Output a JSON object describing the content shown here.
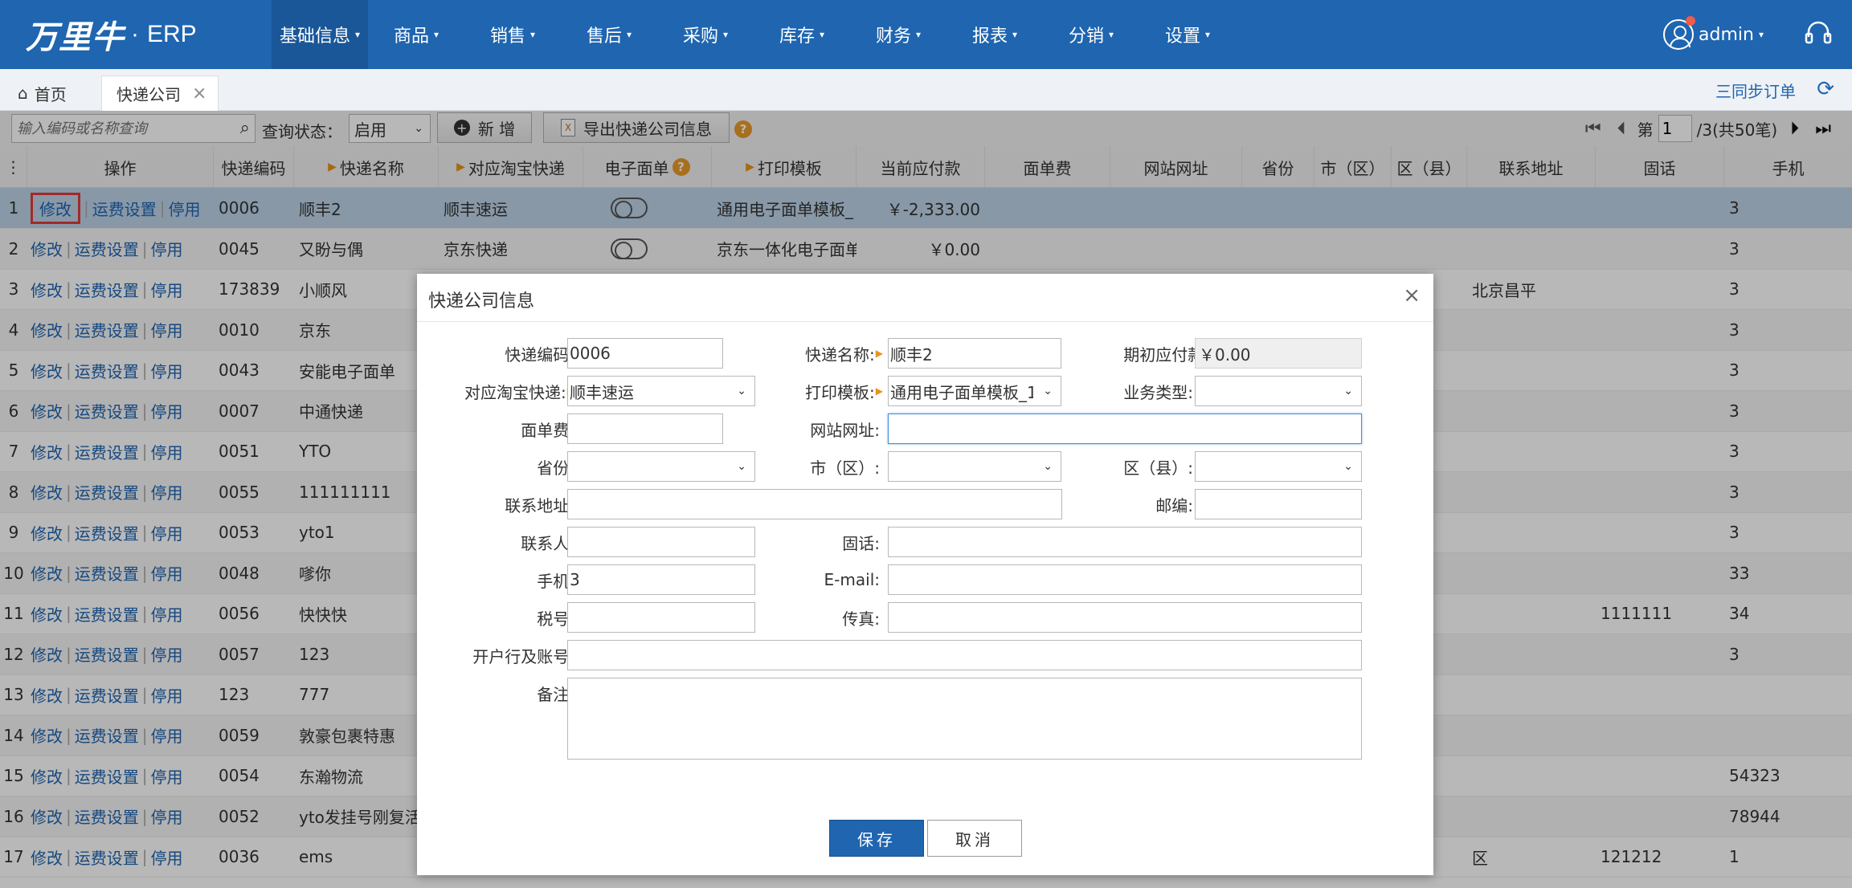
{
  "app": {
    "brand": "万里牛",
    "dot": "·",
    "product": "ERP"
  },
  "nav": [
    "基础信息",
    "商品",
    "销售",
    "售后",
    "采购",
    "库存",
    "财务",
    "报表",
    "分销",
    "设置"
  ],
  "user": {
    "name": "admin"
  },
  "tabs": {
    "home": "首页",
    "active": "快递公司"
  },
  "sync_orders": "三同步订单",
  "toolbar": {
    "search_placeholder": "输入编码或名称查询",
    "status_label": "查询状态：",
    "status_value": "启用",
    "add_label": "新 增",
    "export_label": "导出快递公司信息",
    "page_label": "第",
    "page_value": "1",
    "page_total": "/3(共50笔)"
  },
  "columns": {
    "ops": "操作",
    "code": "快递编码",
    "name": "快递名称",
    "taobao": "对应淘宝快递",
    "esheet": "电子面单",
    "template": "打印模板",
    "payable": "当前应付款",
    "fee": "面单费",
    "website": "网站网址",
    "province": "省份",
    "city": "市（区）",
    "district": "区（县）",
    "address": "联系地址",
    "phone": "固话",
    "mobile": "手机"
  },
  "row_ops": {
    "edit": "修改",
    "freight": "运费设置",
    "disable": "停用"
  },
  "rows": [
    {
      "no": "1",
      "code": "0006",
      "name": "顺丰2",
      "taobao": "顺丰速运",
      "esheet": true,
      "template": "通用电子面单模板_",
      "payable": "￥-2,333.00",
      "address": "",
      "phone": "",
      "mobile": "3"
    },
    {
      "no": "2",
      "code": "0045",
      "name": "又盼与偶",
      "taobao": "京东快递",
      "esheet": true,
      "template": "京东一体化电子面单",
      "payable": "￥0.00",
      "address": "",
      "phone": "",
      "mobile": "3"
    },
    {
      "no": "3",
      "code": "173839",
      "name": "小顺风",
      "taobao": "",
      "esheet": false,
      "template": "",
      "payable": "",
      "address": "北京昌平",
      "phone": "",
      "mobile": "3"
    },
    {
      "no": "4",
      "code": "0010",
      "name": "京东",
      "taobao": "",
      "esheet": false,
      "template": "",
      "payable": "",
      "address": "",
      "phone": "",
      "mobile": "3"
    },
    {
      "no": "5",
      "code": "0043",
      "name": "安能电子面单",
      "taobao": "",
      "esheet": false,
      "template": "",
      "payable": "",
      "address": "",
      "phone": "",
      "mobile": "3"
    },
    {
      "no": "6",
      "code": "0007",
      "name": "中通快递",
      "taobao": "",
      "esheet": false,
      "template": "",
      "payable": "",
      "address": "",
      "phone": "",
      "mobile": "3"
    },
    {
      "no": "7",
      "code": "0051",
      "name": "YTO",
      "taobao": "",
      "esheet": false,
      "template": "",
      "payable": "",
      "address": "",
      "phone": "",
      "mobile": "3"
    },
    {
      "no": "8",
      "code": "0055",
      "name": "111111111",
      "taobao": "",
      "esheet": false,
      "template": "",
      "payable": "",
      "address": "",
      "phone": "",
      "mobile": "3"
    },
    {
      "no": "9",
      "code": "0053",
      "name": "yto1",
      "taobao": "",
      "esheet": false,
      "template": "",
      "payable": "",
      "address": "",
      "phone": "",
      "mobile": "3"
    },
    {
      "no": "10",
      "code": "0048",
      "name": "嗲你",
      "taobao": "",
      "esheet": false,
      "template": "",
      "payable": "",
      "address": "",
      "phone": "",
      "mobile": "33"
    },
    {
      "no": "11",
      "code": "0056",
      "name": "快快快",
      "taobao": "",
      "esheet": false,
      "template": "",
      "payable": "",
      "address": "",
      "phone": "1111111",
      "mobile": "34"
    },
    {
      "no": "12",
      "code": "0057",
      "name": "123",
      "taobao": "",
      "esheet": false,
      "template": "",
      "payable": "",
      "address": "",
      "phone": "",
      "mobile": "3"
    },
    {
      "no": "13",
      "code": "123",
      "name": "777",
      "taobao": "",
      "esheet": false,
      "template": "",
      "payable": "",
      "address": "",
      "phone": "",
      "mobile": ""
    },
    {
      "no": "14",
      "code": "0059",
      "name": "敦豪包裹特惠",
      "taobao": "",
      "esheet": false,
      "template": "",
      "payable": "",
      "address": "",
      "phone": "",
      "mobile": ""
    },
    {
      "no": "15",
      "code": "0054",
      "name": "东瀚物流",
      "taobao": "",
      "esheet": false,
      "template": "",
      "payable": "",
      "address": "",
      "phone": "",
      "mobile": "54323"
    },
    {
      "no": "16",
      "code": "0052",
      "name": "yto发挂号刚复活",
      "taobao": "",
      "esheet": false,
      "template": "",
      "payable": "",
      "address": "",
      "phone": "",
      "mobile": "78944"
    },
    {
      "no": "17",
      "code": "0036",
      "name": "ems",
      "taobao": "",
      "esheet": false,
      "template": "",
      "payable": "",
      "address": "区",
      "phone": "121212",
      "mobile": "1"
    }
  ],
  "modal": {
    "title": "快递公司信息",
    "close": "×",
    "code_label": "快递编码:",
    "code_value": "0006",
    "name_label": "快递名称:",
    "name_value": "顺丰2",
    "opening_label": "期初应付款:",
    "opening_value": "￥0.00",
    "taobao_label": "对应淘宝快递:",
    "taobao_value": "顺丰速运",
    "template_label": "打印模板:",
    "template_value": "通用电子面单模板_1",
    "biztype_label": "业务类型:",
    "biztype_value": "",
    "fee_label": "面单费:",
    "website_label": "网站网址:",
    "province_label": "省份:",
    "city_label": "市（区）:",
    "district_label": "区（县）:",
    "address_label": "联系地址:",
    "zip_label": "邮编:",
    "contact_label": "联系人:",
    "phone_label": "固话:",
    "mobile_label": "手机:",
    "mobile_value": "3",
    "email_label": "E-mail:",
    "tax_label": "税号:",
    "fax_label": "传真:",
    "bank_label": "开户行及账号:",
    "remark_label": "备注:",
    "save": "保存",
    "cancel": "取消"
  }
}
